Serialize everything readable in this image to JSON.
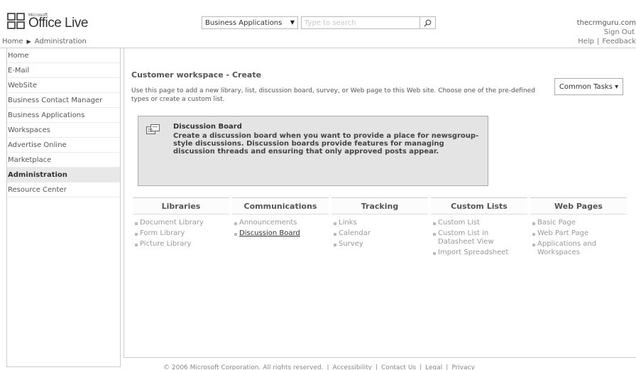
{
  "header": {
    "logo_small": "Microsoft",
    "logo_brand": "Office Live",
    "breadcrumb": [
      "Home",
      "Administration"
    ],
    "search_scope": "Business Applications",
    "search_placeholder": "Type to search",
    "user_name": "thecrmguru.com",
    "sign_out": "Sign Out",
    "help": "Help",
    "feedback": "Feedback"
  },
  "sidebar": {
    "items": [
      {
        "label": "Home"
      },
      {
        "label": "E-Mail"
      },
      {
        "label": "WebSite"
      },
      {
        "label": "Business Contact Manager"
      },
      {
        "label": "Business Applications"
      },
      {
        "label": "Workspaces"
      },
      {
        "label": "Advertise Online"
      },
      {
        "label": "Marketplace"
      },
      {
        "label": "Administration",
        "active": true
      },
      {
        "label": "Resource Center"
      }
    ]
  },
  "main": {
    "title": "Customer workspace - Create",
    "description": "Use this page to add a new library, list, discussion board, survey, or Web page to this Web site. Choose one of the pre-defined types or create a custom list.",
    "common_tasks": "Common Tasks ▾",
    "preview": {
      "title": "Discussion Board",
      "description": "Create a discussion board when you want to provide a place for newsgroup-style discussions. Discussion boards provide features for managing discussion threads and ensuring that only approved posts appear."
    },
    "categories": [
      {
        "name": "Libraries",
        "items": [
          "Document Library",
          "Form Library",
          "Picture Library"
        ]
      },
      {
        "name": "Communications",
        "items": [
          "Announcements",
          "Discussion Board"
        ]
      },
      {
        "name": "Tracking",
        "items": [
          "Links",
          "Calendar",
          "Survey"
        ]
      },
      {
        "name": "Custom Lists",
        "items": [
          "Custom List",
          "Custom List in Datasheet View",
          "Import Spreadsheet"
        ]
      },
      {
        "name": "Web Pages",
        "items": [
          "Basic Page",
          "Web Part Page",
          "Applications and Workspaces"
        ]
      }
    ]
  },
  "footer": {
    "copyright": "© 2006 Microsoft Corporation. All rights reserved.",
    "links": [
      "Accessibility",
      "Contact Us",
      "Legal",
      "Privacy"
    ]
  }
}
